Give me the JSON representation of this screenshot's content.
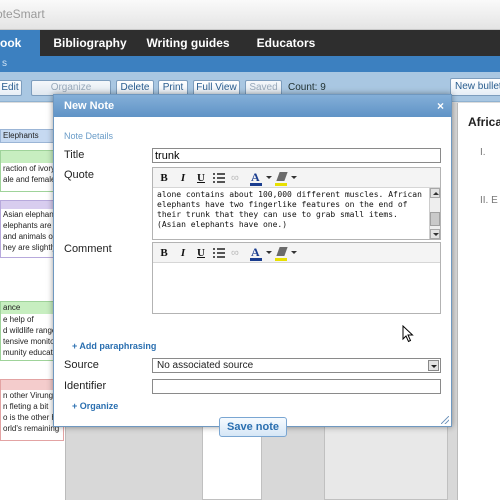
{
  "app": {
    "logo_text": "oteSmart"
  },
  "nav": {
    "tabs": [
      {
        "label": "ook",
        "active": true
      },
      {
        "label": "Bibliography",
        "active": false
      },
      {
        "label": "Writing guides",
        "active": false
      },
      {
        "label": "Educators",
        "active": false
      }
    ],
    "sub_text": "s"
  },
  "toolbar": {
    "edit": "Edit",
    "organize": "Organize",
    "delete": "Delete",
    "print": "Print",
    "full_view": "Full View",
    "saved": "Saved",
    "count": "Count: 9",
    "new_bullet": "New bullet"
  },
  "background_notes": {
    "block1": {
      "header": "Elephants",
      "lines": []
    },
    "block2": {
      "header": "",
      "lines": [
        "raction of ivory.",
        "ale and female"
      ]
    },
    "block3": {
      "header": "",
      "lines": [
        "Asian elephant",
        "elephants are th",
        "and animals on",
        "hey are slightly"
      ]
    },
    "block4": {
      "header": "ance",
      "lines": [
        "e help of",
        "d wildlife ranger",
        "tensive monitori",
        "munity educati"
      ]
    },
    "block5": {
      "header": "",
      "lines": [
        "n other Virung",
        "n fleting a bit",
        "o is the other half",
        "orld's remaining"
      ]
    }
  },
  "outline": {
    "title": "African",
    "items": [
      "I.",
      "II. E"
    ]
  },
  "modal": {
    "title": "New Note",
    "close_symbol": "×",
    "section_label": "Note Details",
    "labels": {
      "title": "Title",
      "quote": "Quote",
      "comment": "Comment",
      "source": "Source",
      "identifier": "Identifier"
    },
    "title_value": "trunk",
    "quote_text": "alone contains about 100,000 different muscles. African elephants have two fingerlike features on the end of their trunk that they can use to grab small items. (Asian elephants have one.)",
    "comment_text": "",
    "rte_buttons": {
      "bold": "B",
      "italic": "I",
      "underline": "U",
      "font_color": "A"
    },
    "add_paraphrasing": "+ Add paraphrasing",
    "source_value": "No associated source",
    "identifier_value": "",
    "organize_link": "+ Organize",
    "save_button": "Save note"
  },
  "colors": {
    "nav_active": "#3c80c0",
    "toolbar_bg": "#a9c7e2",
    "modal_header": "#6a9cc8",
    "link": "#2a6fb0",
    "note_blue": "#c6d9f1",
    "note_green": "#c7eec0",
    "note_purple": "#d8cdef",
    "note_red": "#f4cccc"
  },
  "icons": [
    "close-icon",
    "bold-icon",
    "italic-icon",
    "underline-icon",
    "bullet-list-icon",
    "link-icon",
    "font-color-icon",
    "highlight-icon",
    "scroll-up-icon",
    "scroll-down-icon",
    "dropdown-arrow-icon",
    "resize-grip-icon",
    "mouse-cursor-icon"
  ]
}
